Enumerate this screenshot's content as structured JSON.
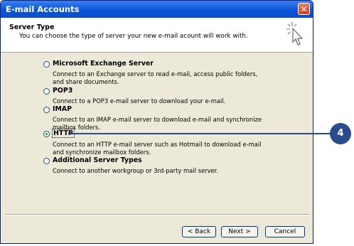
{
  "window": {
    "title": "E-mail Accounts",
    "close_glyph": "✕"
  },
  "header": {
    "title": "Server Type",
    "subtitle": "You can choose the type of server your new e-mail acount will work with.",
    "icon": "wizard-sparkle-cursor-icon"
  },
  "options": [
    {
      "label": "Microsoft Exchange Server",
      "desc": "Connect to an Exchange server to read e-mail, access public folders, and share documents.",
      "selected": false
    },
    {
      "label": "POP3",
      "desc": "Connect to a POP3 e-mail server to download your e-mail.",
      "selected": false
    },
    {
      "label": "IMAP",
      "desc": "Connect to an IMAP e-mail server to download e-mail and synchronize mailbox folders.",
      "selected": false
    },
    {
      "label": "HTTP",
      "desc": "Connect to an HTTP e-mail server such as Hotmail to download e-mail and synchronize mailbox folders.",
      "selected": true
    },
    {
      "label": "Additional Server Types",
      "desc": "Connect to another workgroup or 3rd-party mail server.",
      "selected": false
    }
  ],
  "buttons": {
    "back": "< Back",
    "next": "Next >",
    "cancel": "Cancel"
  },
  "callout": {
    "number": "4",
    "color": "#2b4c8c"
  }
}
